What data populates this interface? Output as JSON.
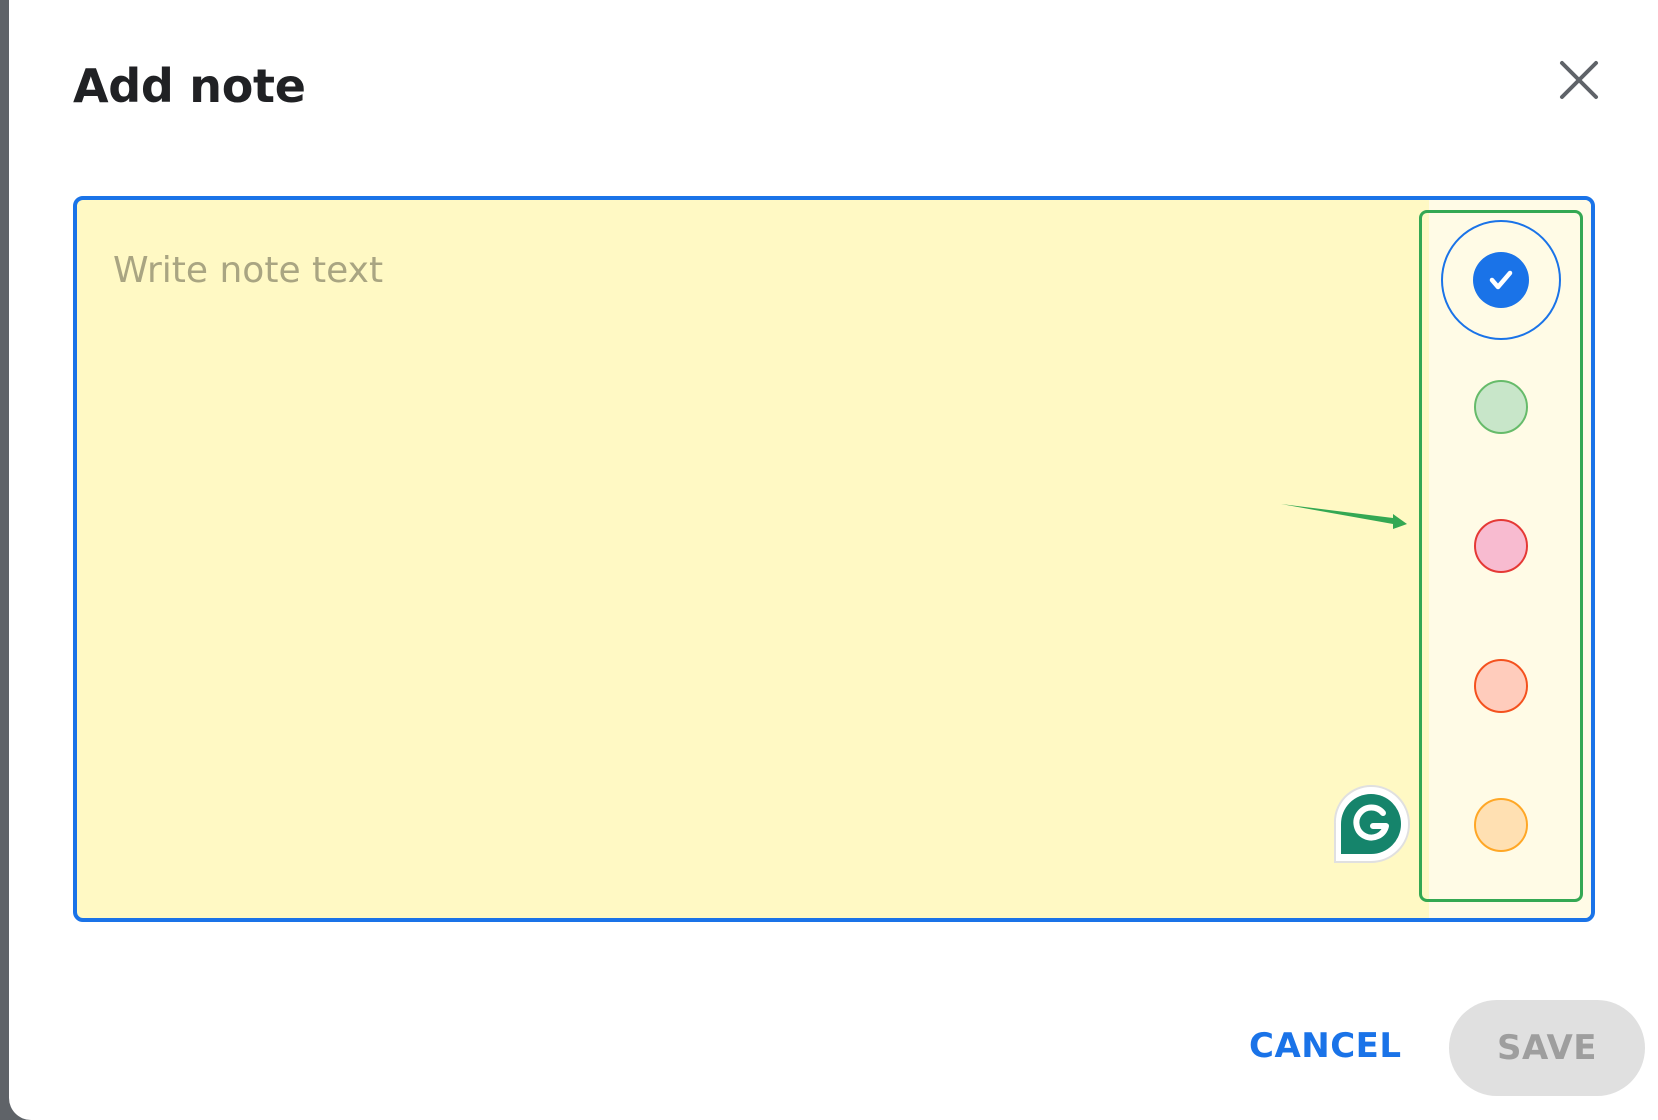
{
  "dialog": {
    "title": "Add note",
    "close_icon": "close-icon"
  },
  "note": {
    "placeholder": "Write note text",
    "value": ""
  },
  "colors": {
    "accent": "#1a73e8",
    "note_background": "#fff9c4",
    "highlight": "#34a853",
    "swatches": [
      {
        "name": "yellow",
        "fill": "#fff9c4",
        "border": "#1a73e8",
        "selected": true
      },
      {
        "name": "green",
        "fill": "#c8e6c9",
        "border": "#66bb6a",
        "selected": false
      },
      {
        "name": "pink",
        "fill": "#f8bbd0",
        "border": "#e53935",
        "selected": false
      },
      {
        "name": "salmon",
        "fill": "#ffccbc",
        "border": "#f4511e",
        "selected": false
      },
      {
        "name": "orange",
        "fill": "#ffe0b2",
        "border": "#ffa726",
        "selected": false
      }
    ]
  },
  "icons": {
    "selected_swatch": "check-icon",
    "extension": "grammarly-icon",
    "pointer": "arrow-icon"
  },
  "actions": {
    "cancel_label": "CANCEL",
    "save_label": "SAVE",
    "save_enabled": false
  }
}
